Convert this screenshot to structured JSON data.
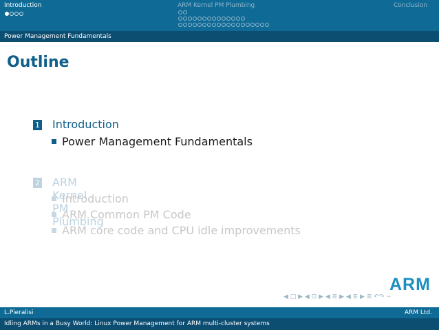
{
  "header": {
    "sections": [
      {
        "label": "Introduction",
        "active": true
      },
      {
        "label": "ARM Kernel PM Plumbing",
        "active": false
      },
      {
        "label": "Conclusion",
        "active": false
      }
    ],
    "subsection": "Power Management Fundamentals"
  },
  "frame": {
    "title": "Outline",
    "toc": [
      {
        "number": "1",
        "title": "Introduction",
        "shaded": false,
        "items": [
          "Power Management Fundamentals"
        ]
      },
      {
        "number": "2",
        "title": "ARM Kernel PM Plumbing",
        "shaded": true,
        "items": [
          "Introduction",
          "ARM Common PM Code",
          "ARM core code and CPU idle improvements"
        ]
      }
    ]
  },
  "logo": "ARM",
  "nav_symbols": "◀ □ ▶ ◀ ⊡ ▶ ◀ ≣ ▶ ◀ ≣ ▶ ≣ ↶↷ ∽",
  "footer": {
    "author": "L.Pieralisi",
    "institute": "ARM Ltd.",
    "talk_title": "Idling ARMs in a Busy World: Linux Power Management for ARM multi-cluster systems"
  }
}
